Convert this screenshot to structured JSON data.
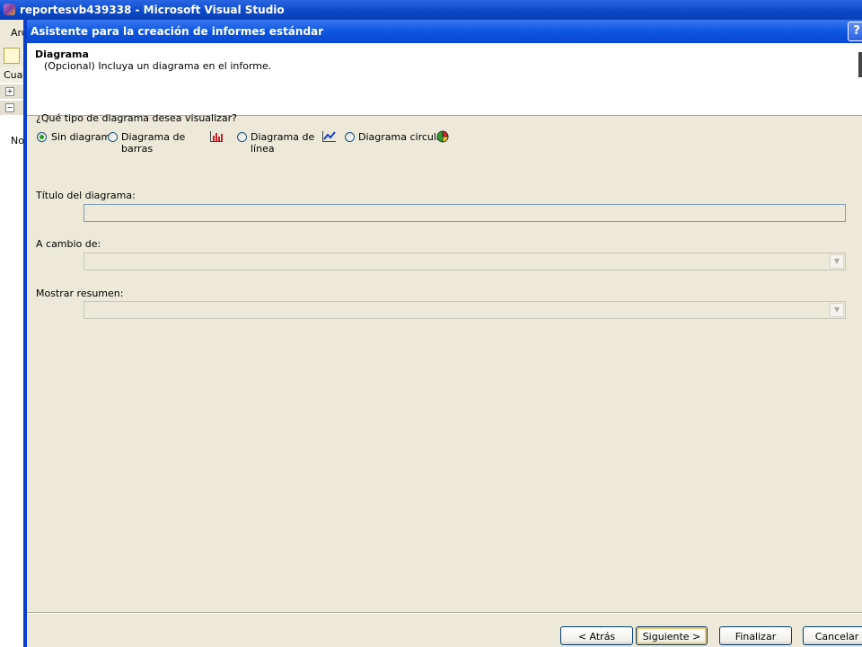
{
  "vs_window": {
    "title": "reportesvb439338 - Microsoft Visual Studio",
    "menu_first": "Arc",
    "panel_header": "Cuad",
    "panel_text": "No"
  },
  "wizard": {
    "title": "Asistente para la creación de informes estándar",
    "help": "?",
    "header": {
      "title": "Diagrama",
      "subtitle": "(Opcional) Incluya un diagrama en el informe."
    },
    "question": "¿Qué tipo de diagrama desea visualizar?",
    "chart_types": [
      {
        "label": "Sin diagrama",
        "selected": true,
        "icon": ""
      },
      {
        "label_line1": "Diagrama de",
        "label_line2": "barras",
        "selected": false,
        "icon": "bar-chart-icon"
      },
      {
        "label_line1": "Diagrama de",
        "label_line2": "línea",
        "selected": false,
        "icon": "line-chart-icon"
      },
      {
        "label": "Diagrama circular",
        "selected": false,
        "icon": "pie-chart-icon"
      }
    ],
    "fields": {
      "title_label": "Título del diagrama:",
      "title_value": "",
      "on_change_label": "A cambio de:",
      "on_change_value": "",
      "summary_label": "Mostrar resumen:",
      "summary_value": ""
    },
    "buttons": {
      "back": "< Atrás",
      "next": "Siguiente >",
      "finish": "Finalizar",
      "cancel": "Cancelar"
    }
  }
}
